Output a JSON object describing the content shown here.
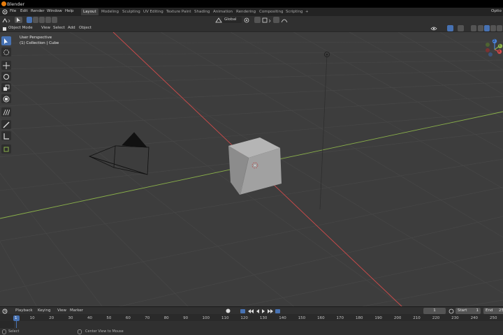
{
  "window": {
    "title": "Blender"
  },
  "menu": [
    "File",
    "Edit",
    "Render",
    "Window",
    "Help"
  ],
  "workspaces": [
    "Layout",
    "Modeling",
    "Sculpting",
    "UV Editing",
    "Texture Paint",
    "Shading",
    "Animation",
    "Rendering",
    "Compositing",
    "Scripting"
  ],
  "active_workspace": "Layout",
  "add_workspace": "+",
  "options_label": "Optio",
  "header": {
    "orientation": "Global"
  },
  "view_menu": {
    "mode": "Object Mode",
    "items": [
      "View",
      "Select",
      "Add",
      "Object"
    ]
  },
  "viewport": {
    "view_name": "User Perspective",
    "collection_info": "(1) Collection | Cube"
  },
  "gizmo_axes": {
    "x": "X",
    "y": "Y",
    "z": "Z"
  },
  "timeline": {
    "menus": [
      "Playback",
      "Keying",
      "View",
      "Marker"
    ],
    "current_frame": "1",
    "start_label": "Start",
    "start_value": "1",
    "end_label": "End",
    "end_value": "25",
    "ticks": [
      "1",
      "10",
      "20",
      "30",
      "40",
      "50",
      "60",
      "70",
      "80",
      "90",
      "100",
      "110",
      "120",
      "130",
      "140",
      "150",
      "160",
      "170",
      "180",
      "190",
      "200",
      "210",
      "220",
      "230",
      "240",
      "250"
    ]
  },
  "status": {
    "left": "Select",
    "center": "Center View to Mouse"
  },
  "colors": {
    "x_axis": "#d24b4b",
    "y_axis": "#8bb24a",
    "accent": "#4772b3",
    "active_frame": "#4772b3"
  }
}
